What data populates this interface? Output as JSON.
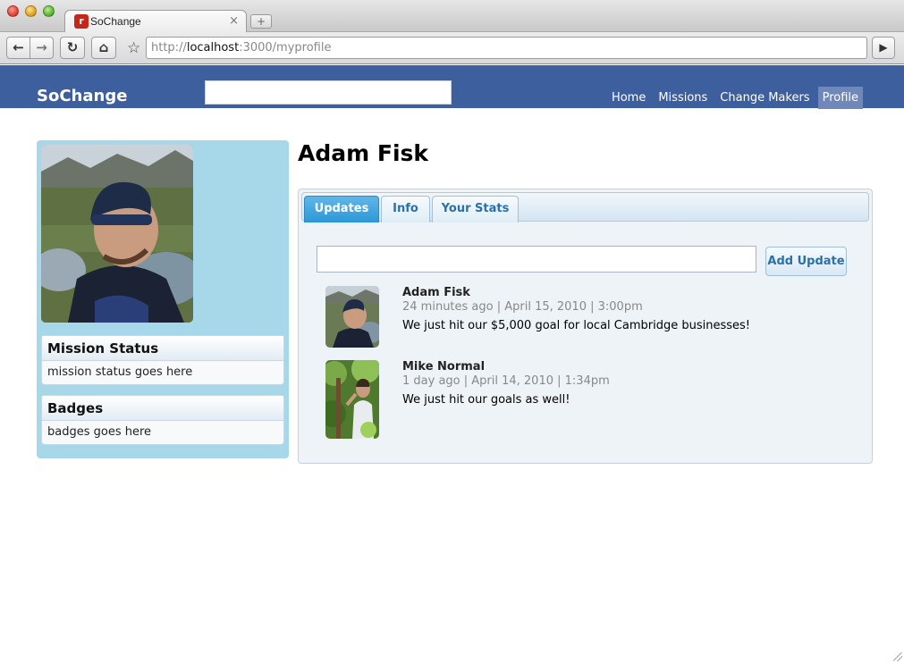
{
  "browser": {
    "tab_title": "SoChange",
    "tab_close": "×",
    "new_tab": "+",
    "url_prefix": "http://",
    "url_host": "localhost",
    "url_rest": ":3000/myprofile",
    "back": "←",
    "forward": "→",
    "reload": "↻",
    "home": "⌂",
    "star": "☆",
    "go": "▶"
  },
  "site": {
    "brand": "SoChange",
    "search_value": "",
    "nav": [
      {
        "label": "Home"
      },
      {
        "label": "Missions"
      },
      {
        "label": "Change Makers"
      },
      {
        "label": "Profile"
      }
    ],
    "colors": {
      "header": "#3e5f9e",
      "sidebar": "#a6d8ea",
      "active_tab": "#2c97d6"
    }
  },
  "sidebar": {
    "mission_status": {
      "title": "Mission Status",
      "body": "mission status goes here"
    },
    "badges": {
      "title": "Badges",
      "body": "badges goes here"
    }
  },
  "profile": {
    "name": "Adam Fisk",
    "tabs": [
      {
        "label": "Updates",
        "active": true
      },
      {
        "label": "Info"
      },
      {
        "label": "Your Stats"
      }
    ],
    "update_input_value": "",
    "add_update_label": "Add Update",
    "updates": [
      {
        "author": "Adam Fisk",
        "meta": "24 minutes ago | April 15, 2010 | 3:00pm",
        "text": "We just hit our $5,000 goal for local Cambridge businesses!"
      },
      {
        "author": "Mike Normal",
        "meta": "1 day ago | April 14, 2010 | 1:34pm",
        "text": "We just hit our goals as well!"
      }
    ]
  }
}
